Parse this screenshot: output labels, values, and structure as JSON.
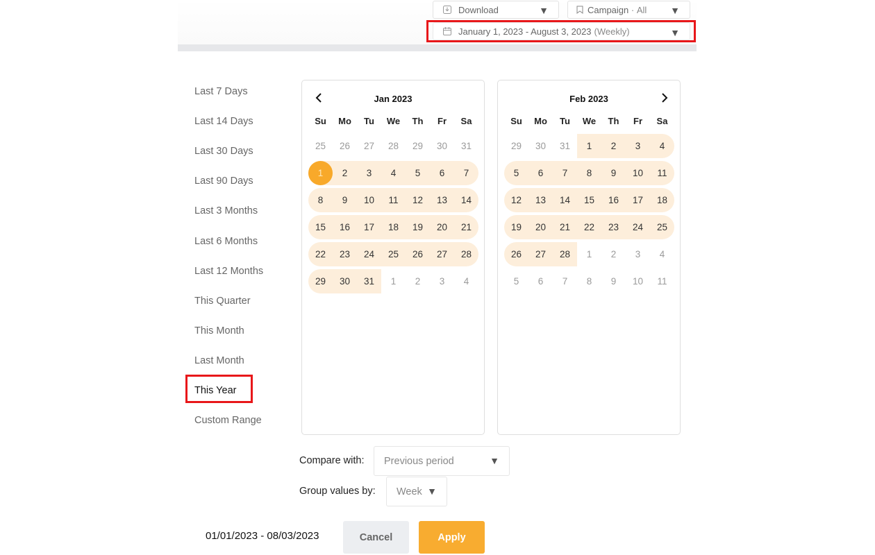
{
  "toolbar": {
    "download_label": "Download",
    "campaign_label": "Campaign",
    "campaign_value": "All",
    "date_range_label": "January 1, 2023 - August 3, 2023",
    "date_range_granularity": "(Weekly)"
  },
  "presets": [
    {
      "label": "Last 7 Days",
      "active": false
    },
    {
      "label": "Last 14 Days",
      "active": false
    },
    {
      "label": "Last 30 Days",
      "active": false
    },
    {
      "label": "Last 90 Days",
      "active": false
    },
    {
      "label": "Last 3 Months",
      "active": false
    },
    {
      "label": "Last 6 Months",
      "active": false
    },
    {
      "label": "Last 12 Months",
      "active": false
    },
    {
      "label": "This Quarter",
      "active": false
    },
    {
      "label": "This Month",
      "active": false
    },
    {
      "label": "Last Month",
      "active": false
    },
    {
      "label": "This Year",
      "active": true
    },
    {
      "label": "Custom Range",
      "active": false
    }
  ],
  "weekdays": [
    "Su",
    "Mo",
    "Tu",
    "We",
    "Th",
    "Fr",
    "Sa"
  ],
  "calendars": [
    {
      "title": "Jan 2023",
      "nav": "prev",
      "weeks": [
        [
          {
            "d": "25",
            "out": true
          },
          {
            "d": "26",
            "out": true
          },
          {
            "d": "27",
            "out": true
          },
          {
            "d": "28",
            "out": true
          },
          {
            "d": "29",
            "out": true
          },
          {
            "d": "30",
            "out": true
          },
          {
            "d": "31",
            "out": true
          }
        ],
        [
          {
            "d": "1",
            "in": true,
            "start": true
          },
          {
            "d": "2",
            "in": true
          },
          {
            "d": "3",
            "in": true
          },
          {
            "d": "4",
            "in": true
          },
          {
            "d": "5",
            "in": true
          },
          {
            "d": "6",
            "in": true
          },
          {
            "d": "7",
            "in": true
          }
        ],
        [
          {
            "d": "8",
            "in": true
          },
          {
            "d": "9",
            "in": true
          },
          {
            "d": "10",
            "in": true
          },
          {
            "d": "11",
            "in": true
          },
          {
            "d": "12",
            "in": true
          },
          {
            "d": "13",
            "in": true
          },
          {
            "d": "14",
            "in": true
          }
        ],
        [
          {
            "d": "15",
            "in": true
          },
          {
            "d": "16",
            "in": true
          },
          {
            "d": "17",
            "in": true
          },
          {
            "d": "18",
            "in": true
          },
          {
            "d": "19",
            "in": true
          },
          {
            "d": "20",
            "in": true
          },
          {
            "d": "21",
            "in": true
          }
        ],
        [
          {
            "d": "22",
            "in": true
          },
          {
            "d": "23",
            "in": true
          },
          {
            "d": "24",
            "in": true
          },
          {
            "d": "25",
            "in": true
          },
          {
            "d": "26",
            "in": true
          },
          {
            "d": "27",
            "in": true
          },
          {
            "d": "28",
            "in": true
          }
        ],
        [
          {
            "d": "29",
            "in": true
          },
          {
            "d": "30",
            "in": true
          },
          {
            "d": "31",
            "in": true
          },
          {
            "d": "1",
            "out": true
          },
          {
            "d": "2",
            "out": true
          },
          {
            "d": "3",
            "out": true
          },
          {
            "d": "4",
            "out": true
          }
        ]
      ]
    },
    {
      "title": "Feb 2023",
      "nav": "next",
      "weeks": [
        [
          {
            "d": "29",
            "out": true
          },
          {
            "d": "30",
            "out": true
          },
          {
            "d": "31",
            "out": true
          },
          {
            "d": "1",
            "in": true
          },
          {
            "d": "2",
            "in": true
          },
          {
            "d": "3",
            "in": true
          },
          {
            "d": "4",
            "in": true
          }
        ],
        [
          {
            "d": "5",
            "in": true
          },
          {
            "d": "6",
            "in": true
          },
          {
            "d": "7",
            "in": true
          },
          {
            "d": "8",
            "in": true
          },
          {
            "d": "9",
            "in": true
          },
          {
            "d": "10",
            "in": true
          },
          {
            "d": "11",
            "in": true
          }
        ],
        [
          {
            "d": "12",
            "in": true
          },
          {
            "d": "13",
            "in": true
          },
          {
            "d": "14",
            "in": true
          },
          {
            "d": "15",
            "in": true
          },
          {
            "d": "16",
            "in": true
          },
          {
            "d": "17",
            "in": true
          },
          {
            "d": "18",
            "in": true
          }
        ],
        [
          {
            "d": "19",
            "in": true
          },
          {
            "d": "20",
            "in": true
          },
          {
            "d": "21",
            "in": true
          },
          {
            "d": "22",
            "in": true
          },
          {
            "d": "23",
            "in": true
          },
          {
            "d": "24",
            "in": true
          },
          {
            "d": "25",
            "in": true
          }
        ],
        [
          {
            "d": "26",
            "in": true
          },
          {
            "d": "27",
            "in": true
          },
          {
            "d": "28",
            "in": true
          },
          {
            "d": "1",
            "out": true
          },
          {
            "d": "2",
            "out": true
          },
          {
            "d": "3",
            "out": true
          },
          {
            "d": "4",
            "out": true
          }
        ],
        [
          {
            "d": "5",
            "out": true
          },
          {
            "d": "6",
            "out": true
          },
          {
            "d": "7",
            "out": true
          },
          {
            "d": "8",
            "out": true
          },
          {
            "d": "9",
            "out": true
          },
          {
            "d": "10",
            "out": true
          },
          {
            "d": "11",
            "out": true
          }
        ]
      ]
    }
  ],
  "compare": {
    "label": "Compare with:",
    "value": "Previous period"
  },
  "group": {
    "label": "Group values by:",
    "value": "Week"
  },
  "summary": "01/01/2023 - 08/03/2023",
  "buttons": {
    "cancel": "Cancel",
    "apply": "Apply"
  },
  "colors": {
    "accent": "#f8a92a",
    "range_fill": "#fdeedb",
    "highlight": "#e8171a"
  },
  "icons": {
    "download": "download-icon",
    "campaign": "bookmark-icon",
    "date": "calendar-icon",
    "caret": "caret-down-icon"
  }
}
